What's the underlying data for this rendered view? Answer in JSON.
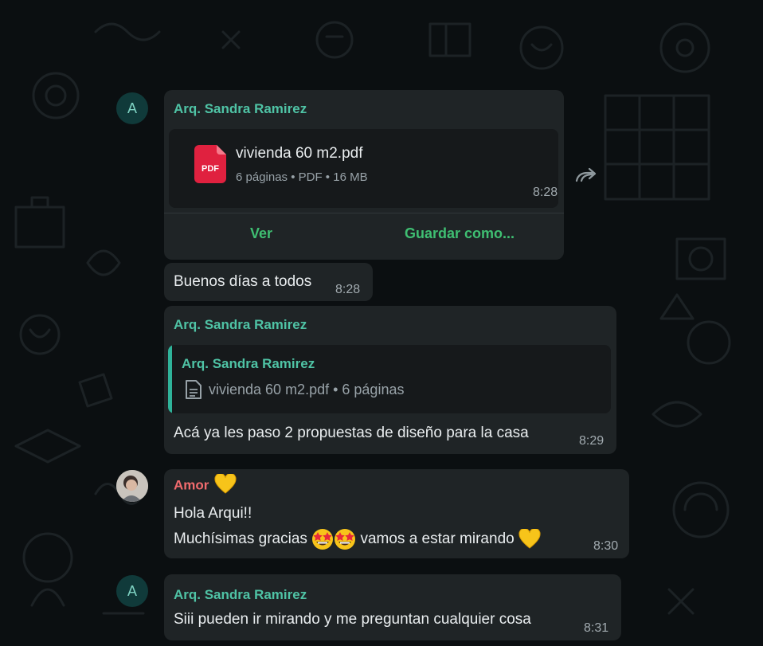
{
  "messages": [
    {
      "avatar_letter": "A",
      "sender": "Arq. Sandra Ramirez",
      "document": {
        "name": "vivienda 60 m2.pdf",
        "icon_label": "PDF",
        "meta": "6 páginas • PDF • 16 MB"
      },
      "time": "8:28",
      "actions": {
        "view": "Ver",
        "save": "Guardar como..."
      }
    },
    {
      "text": "Buenos días a todos",
      "time": "8:28"
    },
    {
      "sender": "Arq. Sandra Ramirez",
      "quote": {
        "sender": "Arq. Sandra Ramirez",
        "text": "vivienda 60 m2.pdf • 6 páginas"
      },
      "text": "Acá ya les paso 2 propuestas de diseño para la casa",
      "time": "8:29"
    },
    {
      "sender": "Amor",
      "line1": "Hola Arqui!!",
      "line2_before": "Muchísimas gracias",
      "line2_after": "vamos a estar mirando",
      "time": "8:30"
    },
    {
      "avatar_letter": "A",
      "sender": "Arq. Sandra Ramirez",
      "text": "Siii pueden ir mirando y me preguntan cualquier cosa",
      "time": "8:31"
    }
  ],
  "icons": {
    "forward": "forward-icon",
    "pdf": "pdf-file-icon",
    "document": "document-icon",
    "heart": "yellow-heart-emoji",
    "star_struck": "star-struck-emoji"
  },
  "colors": {
    "background": "#0b0f11",
    "bubble": "#1f2426",
    "sender_teal": "#4fc3a5",
    "sender_red": "#f16b6e",
    "action_green": "#3fbf72"
  }
}
